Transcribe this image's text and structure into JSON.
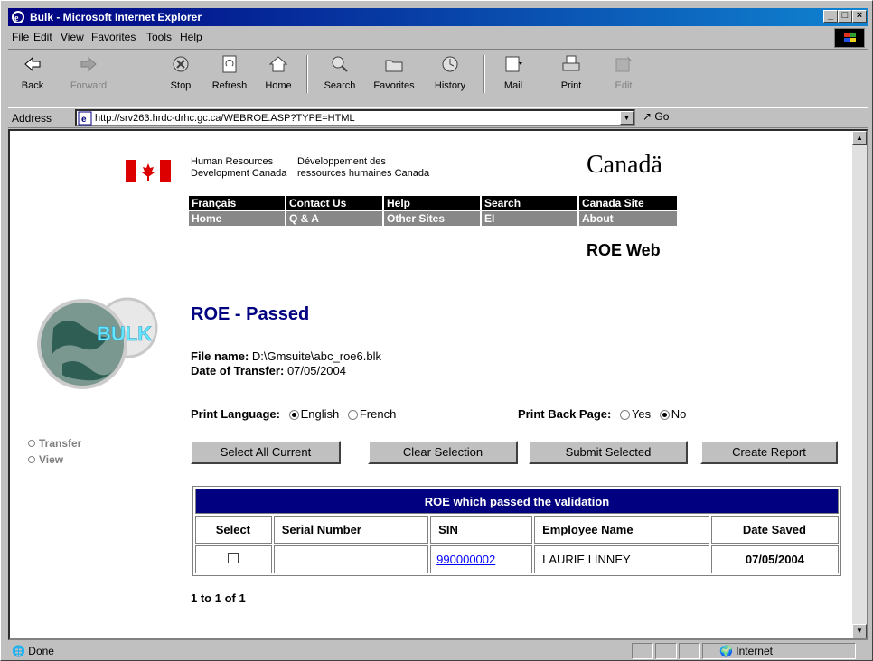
{
  "window": {
    "title": "Bulk - Microsoft Internet Explorer",
    "controls": {
      "minimize": "_",
      "maximize": "□",
      "close": "×"
    }
  },
  "menu": {
    "items": [
      "File",
      "Edit",
      "View",
      "Favorites",
      "Tools",
      "Help"
    ]
  },
  "toolbar": {
    "back": "Back",
    "forward": "Forward",
    "stop": "Stop",
    "refresh": "Refresh",
    "home": "Home",
    "search": "Search",
    "favorites": "Favorites",
    "history": "History",
    "mail": "Mail",
    "print": "Print",
    "edit": "Edit"
  },
  "address": {
    "label": "Address",
    "url": "http://srv263.hrdc-drhc.gc.ca/WEBROE.ASP?TYPE=HTML",
    "go": "Go"
  },
  "header": {
    "dept_en_line1": "Human Resources",
    "dept_en_line2": "Development Canada",
    "dept_fr_line1": "Développement des",
    "dept_fr_line2": "ressources humaines Canada",
    "wordmark": "Canadä",
    "nav_row1": [
      "Français",
      "Contact Us",
      "Help",
      "Search",
      "Canada Site"
    ],
    "nav_row2": [
      "Home",
      "Q & A",
      "Other Sites",
      "EI",
      "About"
    ],
    "app_name": "ROE Web"
  },
  "sidebar": {
    "logo_text": "BULK",
    "links": [
      "Transfer",
      "View"
    ]
  },
  "main": {
    "heading": "ROE - Passed",
    "file_label": "File name:",
    "file_value": "D:\\Gmsuite\\abc_roe6.blk",
    "date_label": "Date of Transfer:",
    "date_value": "07/05/2004",
    "print_language": {
      "label": "Print Language:",
      "options": [
        "English",
        "French"
      ],
      "selected": "English"
    },
    "print_back_page": {
      "label": "Print Back Page:",
      "options": [
        "Yes",
        "No"
      ],
      "selected": "No"
    },
    "buttons": [
      "Select All Current",
      "Clear Selection",
      "Submit Selected",
      "Create Report"
    ]
  },
  "table": {
    "caption": "ROE which passed the validation",
    "headers": [
      "Select",
      "Serial Number",
      "SIN",
      "Employee Name",
      "Date Saved"
    ],
    "rows": [
      {
        "select": false,
        "serial": "",
        "sin": "990000002",
        "name": "LAURIE LINNEY",
        "date": "07/05/2004"
      }
    ],
    "count": "1 to 1 of 1"
  },
  "status": {
    "text": "Done",
    "zone": "Internet"
  }
}
